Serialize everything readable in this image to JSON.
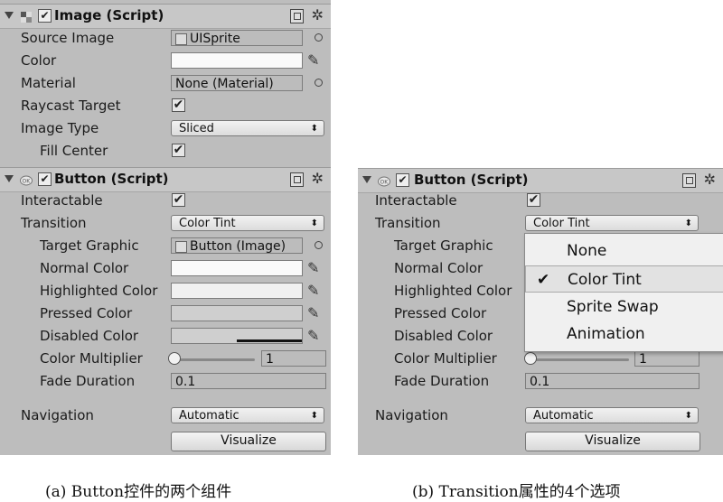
{
  "panel_a": {
    "image_component": {
      "title": "Image (Script)",
      "rows": {
        "source_image": {
          "label": "Source Image",
          "value": "UISprite"
        },
        "color": {
          "label": "Color"
        },
        "material": {
          "label": "Material",
          "value": "None (Material)"
        },
        "raycast_target": {
          "label": "Raycast Target",
          "checked": true
        },
        "image_type": {
          "label": "Image Type",
          "value": "Sliced"
        },
        "fill_center": {
          "label": "Fill Center",
          "checked": true
        }
      }
    },
    "button_component": {
      "title": "Button (Script)",
      "rows": {
        "interactable": {
          "label": "Interactable",
          "checked": true
        },
        "transition": {
          "label": "Transition",
          "value": "Color Tint"
        },
        "target_graphic": {
          "label": "Target Graphic",
          "value": "Button (Image)"
        },
        "normal_color": {
          "label": "Normal Color"
        },
        "highlighted_color": {
          "label": "Highlighted Color"
        },
        "pressed_color": {
          "label": "Pressed Color"
        },
        "disabled_color": {
          "label": "Disabled Color"
        },
        "color_multiplier": {
          "label": "Color Multiplier",
          "value": "1"
        },
        "fade_duration": {
          "label": "Fade Duration",
          "value": "0.1"
        },
        "navigation": {
          "label": "Navigation",
          "value": "Automatic"
        },
        "visualize": "Visualize"
      }
    }
  },
  "panel_b": {
    "button_component": {
      "title": "Button (Script)",
      "rows": {
        "interactable": {
          "label": "Interactable",
          "checked": true
        },
        "transition": {
          "label": "Transition",
          "value": "Color Tint"
        },
        "target_graphic": {
          "label": "Target Graphic"
        },
        "normal_color": {
          "label": "Normal Color"
        },
        "highlighted_color": {
          "label": "Highlighted Color"
        },
        "pressed_color": {
          "label": "Pressed Color"
        },
        "disabled_color": {
          "label": "Disabled Color"
        },
        "color_multiplier": {
          "label": "Color Multiplier",
          "value": "1"
        },
        "fade_duration": {
          "label": "Fade Duration",
          "value": "0.1"
        },
        "navigation": {
          "label": "Navigation",
          "value": "Automatic"
        },
        "visualize": "Visualize"
      }
    },
    "transition_menu": {
      "items": [
        "None",
        "Color Tint",
        "Sprite Swap",
        "Animation"
      ],
      "selected": "Color Tint",
      "check_glyph": "✔"
    }
  },
  "captions": {
    "a": "(a) Button控件的两个组件",
    "b": "(b) Transition属性的4个选项"
  },
  "glyphs": {
    "check": "✔",
    "fold": "▼",
    "dropdown_arrows": "⬍",
    "gear": "✲",
    "picker": "✎"
  },
  "colors": {
    "panel_bg": "#bdbdbd",
    "field_border": "#7c7c7c",
    "menu_bg": "#f0f0f0"
  }
}
